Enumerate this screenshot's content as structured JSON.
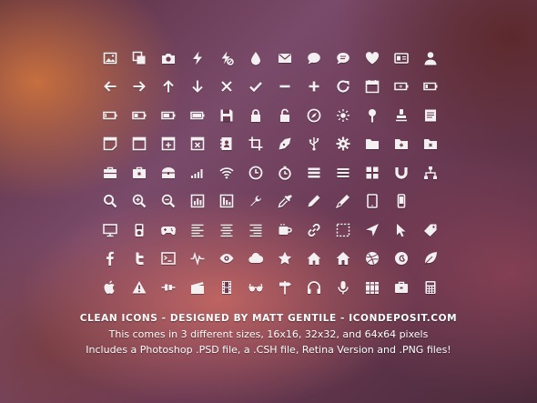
{
  "caption": {
    "title": "CLEAN ICONS - DESIGNED BY MATT GENTILE - ICONDEPOSIT.COM",
    "line1": "This comes in 3 different sizes, 16x16, 32x32, and 64x64 pixels",
    "line2": "Includes a Photoshop .PSD file, a .CSH file, Retina Version and .PNG files!"
  },
  "icon_color": "#f4f0f2",
  "icons": [
    "image-icon",
    "copy-icon",
    "camera-icon",
    "lightning-icon",
    "lightning-off-icon",
    "drop-icon",
    "mail-icon",
    "speech-bubble-icon",
    "chat-icon",
    "heart-icon",
    "id-card-icon",
    "user-icon",
    "arrow-left-icon",
    "arrow-right-icon",
    "arrow-up-icon",
    "arrow-down-icon",
    "close-icon",
    "checkmark-icon",
    "minus-icon",
    "plus-icon",
    "refresh-icon",
    "calendar-icon",
    "battery-charging-icon",
    "battery-low-icon",
    "battery-empty-icon",
    "battery-quarter-icon",
    "battery-half-icon",
    "battery-full-icon",
    "floppy-disk-icon",
    "lock-icon",
    "unlock-icon",
    "compass-icon",
    "brightness-icon",
    "pin-icon",
    "stamp-icon",
    "notepad-icon",
    "note-icon",
    "window-icon",
    "window-add-icon",
    "window-close-icon",
    "address-book-icon",
    "crop-icon",
    "pen-nib-icon",
    "usb-icon",
    "gear-icon",
    "folder-icon",
    "folder-add-icon",
    "folder-remove-icon",
    "toolbox-icon",
    "toolbox-lock-icon",
    "chest-icon",
    "signal-icon",
    "wifi-icon",
    "clock-icon",
    "stopwatch-icon",
    "list-icon",
    "menu-icon",
    "grid-icon",
    "magnet-icon",
    "sitemap-icon",
    "search-icon",
    "zoom-in-icon",
    "zoom-out-icon",
    "bar-chart-icon",
    "bar-chart-alt-icon",
    "wrench-icon",
    "eyedropper-icon",
    "pencil-icon",
    "pen-icon",
    "tablet-icon",
    "phone-icon",
    "empty-icon",
    "monitor-icon",
    "ipod-icon",
    "gamepad-icon",
    "align-left-icon",
    "align-center-icon",
    "align-right-icon",
    "mug-icon",
    "link-icon",
    "selection-icon",
    "navigation-arrow-icon",
    "cursor-icon",
    "tag-icon",
    "facebook-icon",
    "twitter-icon",
    "terminal-icon",
    "pulse-icon",
    "eye-icon",
    "cloud-icon",
    "star-icon",
    "home-icon",
    "home-alt-icon",
    "dribbble-icon",
    "lastfm-icon",
    "leaf-icon",
    "apple-icon",
    "warning-icon",
    "plug-icon",
    "clapperboard-icon",
    "film-icon",
    "glasses-icon",
    "signpost-icon",
    "headphones-icon",
    "microphone-icon",
    "books-icon",
    "briefcase-icon",
    "calculator-icon"
  ]
}
